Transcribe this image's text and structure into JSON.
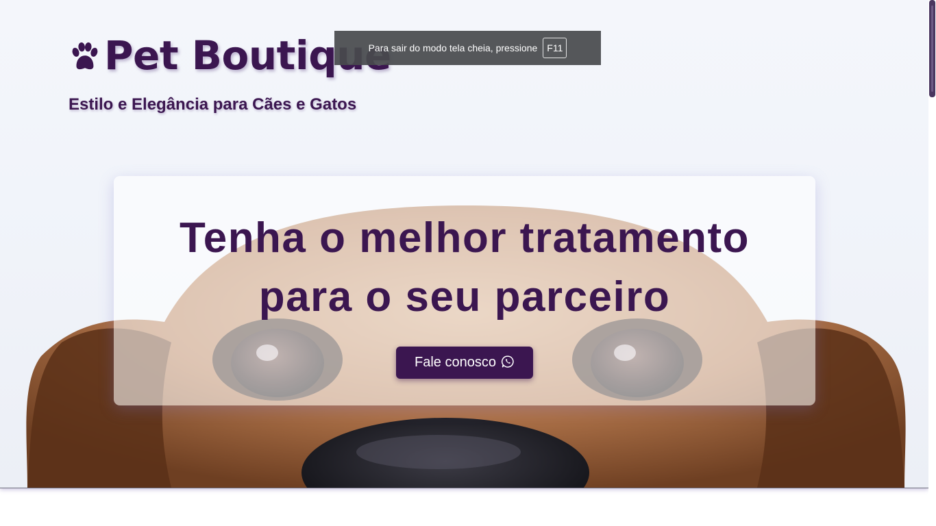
{
  "brand": {
    "title": "Pet Boutique",
    "tagline": "Estilo e Elegância para Cães e Gatos",
    "icon": "paw-icon"
  },
  "hero": {
    "headline_line1": "Tenha o melhor tratamento",
    "headline_line2": "para o seu parceiro",
    "cta_label": "Fale conosco",
    "cta_icon": "whatsapp-icon"
  },
  "fullscreen_notice": {
    "text": "Para sair do modo tela cheia, pressione",
    "key": "F11"
  },
  "colors": {
    "primary": "#3b1650",
    "notice_bg": "#484a4e"
  }
}
